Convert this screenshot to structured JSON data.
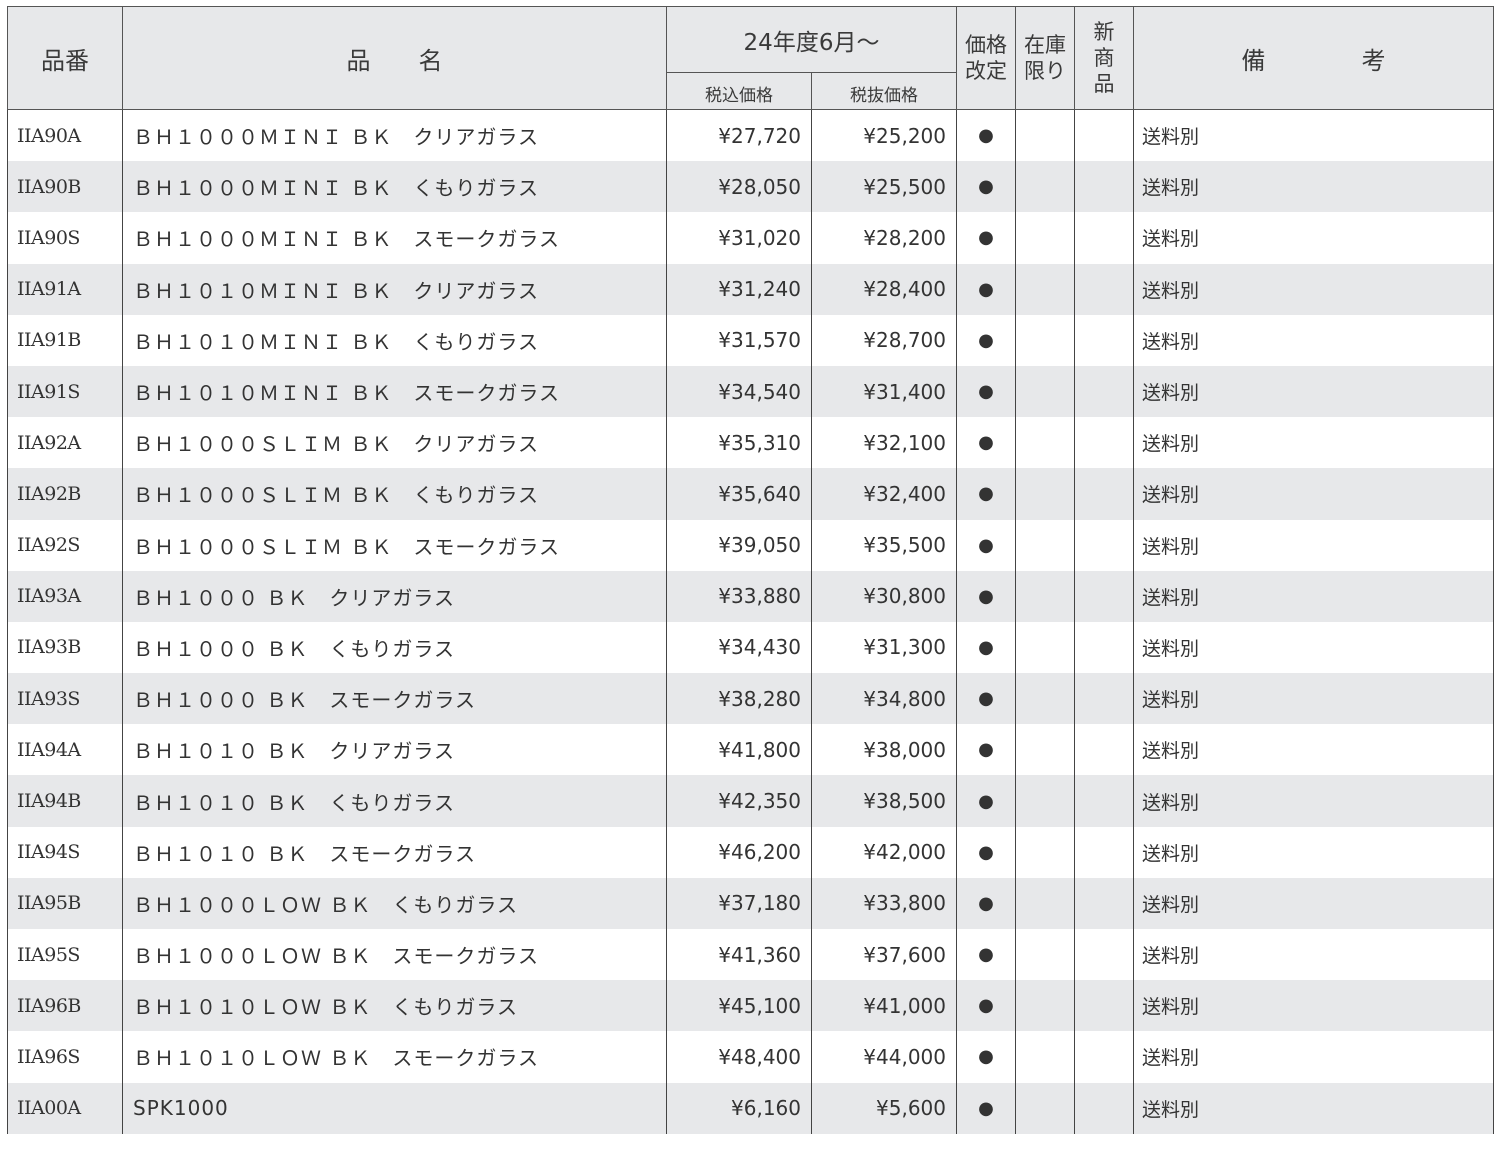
{
  "header": {
    "code": "品番",
    "name": "品　　名",
    "period": "24年度6月～",
    "price_incl": "税込価格",
    "price_excl": "税抜価格",
    "revised_line1": "価格",
    "revised_line2": "改定",
    "stock_line1": "在庫",
    "stock_line2": "限り",
    "new_line1": "新",
    "new_line2": "商",
    "new_line3": "品",
    "remarks_a": "備",
    "remarks_b": "考"
  },
  "rows": [
    {
      "code": "IIA90A",
      "name": "ＢＨ１０００ＭＩＮＩ ＢＫ　クリアガラス",
      "price_incl": "¥27,720",
      "price_excl": "¥25,200",
      "revised": "●",
      "stock": "",
      "new": "",
      "note": "送料別"
    },
    {
      "code": "IIA90B",
      "name": "ＢＨ１０００ＭＩＮＩ ＢＫ　くもりガラス",
      "price_incl": "¥28,050",
      "price_excl": "¥25,500",
      "revised": "●",
      "stock": "",
      "new": "",
      "note": "送料別"
    },
    {
      "code": "IIA90S",
      "name": "ＢＨ１０００ＭＩＮＩ ＢＫ　スモークガラス",
      "price_incl": "¥31,020",
      "price_excl": "¥28,200",
      "revised": "●",
      "stock": "",
      "new": "",
      "note": "送料別"
    },
    {
      "code": "IIA91A",
      "name": "ＢＨ１０１０ＭＩＮＩ ＢＫ　クリアガラス",
      "price_incl": "¥31,240",
      "price_excl": "¥28,400",
      "revised": "●",
      "stock": "",
      "new": "",
      "note": "送料別"
    },
    {
      "code": "IIA91B",
      "name": "ＢＨ１０１０ＭＩＮＩ ＢＫ　くもりガラス",
      "price_incl": "¥31,570",
      "price_excl": "¥28,700",
      "revised": "●",
      "stock": "",
      "new": "",
      "note": "送料別"
    },
    {
      "code": "IIA91S",
      "name": "ＢＨ１０１０ＭＩＮＩ ＢＫ　スモークガラス",
      "price_incl": "¥34,540",
      "price_excl": "¥31,400",
      "revised": "●",
      "stock": "",
      "new": "",
      "note": "送料別"
    },
    {
      "code": "IIA92A",
      "name": "ＢＨ１０００ＳＬＩＭ ＢＫ　クリアガラス",
      "price_incl": "¥35,310",
      "price_excl": "¥32,100",
      "revised": "●",
      "stock": "",
      "new": "",
      "note": "送料別"
    },
    {
      "code": "IIA92B",
      "name": "ＢＨ１０００ＳＬＩＭ ＢＫ　くもりガラス",
      "price_incl": "¥35,640",
      "price_excl": "¥32,400",
      "revised": "●",
      "stock": "",
      "new": "",
      "note": "送料別"
    },
    {
      "code": "IIA92S",
      "name": "ＢＨ１０００ＳＬＩＭ ＢＫ　スモークガラス",
      "price_incl": "¥39,050",
      "price_excl": "¥35,500",
      "revised": "●",
      "stock": "",
      "new": "",
      "note": "送料別"
    },
    {
      "code": "IIA93A",
      "name": "ＢＨ１０００ ＢＫ　クリアガラス",
      "price_incl": "¥33,880",
      "price_excl": "¥30,800",
      "revised": "●",
      "stock": "",
      "new": "",
      "note": "送料別"
    },
    {
      "code": "IIA93B",
      "name": "ＢＨ１０００ ＢＫ　くもりガラス",
      "price_incl": "¥34,430",
      "price_excl": "¥31,300",
      "revised": "●",
      "stock": "",
      "new": "",
      "note": "送料別"
    },
    {
      "code": "IIA93S",
      "name": "ＢＨ１０００ ＢＫ　スモークガラス",
      "price_incl": "¥38,280",
      "price_excl": "¥34,800",
      "revised": "●",
      "stock": "",
      "new": "",
      "note": "送料別"
    },
    {
      "code": "IIA94A",
      "name": "ＢＨ１０１０ ＢＫ　クリアガラス",
      "price_incl": "¥41,800",
      "price_excl": "¥38,000",
      "revised": "●",
      "stock": "",
      "new": "",
      "note": "送料別"
    },
    {
      "code": "IIA94B",
      "name": "ＢＨ１０１０ ＢＫ　くもりガラス",
      "price_incl": "¥42,350",
      "price_excl": "¥38,500",
      "revised": "●",
      "stock": "",
      "new": "",
      "note": "送料別"
    },
    {
      "code": "IIA94S",
      "name": "ＢＨ１０１０ ＢＫ　スモークガラス",
      "price_incl": "¥46,200",
      "price_excl": "¥42,000",
      "revised": "●",
      "stock": "",
      "new": "",
      "note": "送料別"
    },
    {
      "code": "IIA95B",
      "name": "ＢＨ１０００ＬＯＷ ＢＫ　くもりガラス",
      "price_incl": "¥37,180",
      "price_excl": "¥33,800",
      "revised": "●",
      "stock": "",
      "new": "",
      "note": "送料別"
    },
    {
      "code": "IIA95S",
      "name": "ＢＨ１０００ＬＯＷ ＢＫ　スモークガラス",
      "price_incl": "¥41,360",
      "price_excl": "¥37,600",
      "revised": "●",
      "stock": "",
      "new": "",
      "note": "送料別"
    },
    {
      "code": "IIA96B",
      "name": "ＢＨ１０１０ＬＯＷ ＢＫ　くもりガラス",
      "price_incl": "¥45,100",
      "price_excl": "¥41,000",
      "revised": "●",
      "stock": "",
      "new": "",
      "note": "送料別"
    },
    {
      "code": "IIA96S",
      "name": "ＢＨ１０１０ＬＯＷ ＢＫ　スモークガラス",
      "price_incl": "¥48,400",
      "price_excl": "¥44,000",
      "revised": "●",
      "stock": "",
      "new": "",
      "note": "送料別"
    },
    {
      "code": "IIA00A",
      "name": "SPK1000",
      "price_incl": "¥6,160",
      "price_excl": "¥5,600",
      "revised": "●",
      "stock": "",
      "new": "",
      "note": "送料別"
    }
  ]
}
